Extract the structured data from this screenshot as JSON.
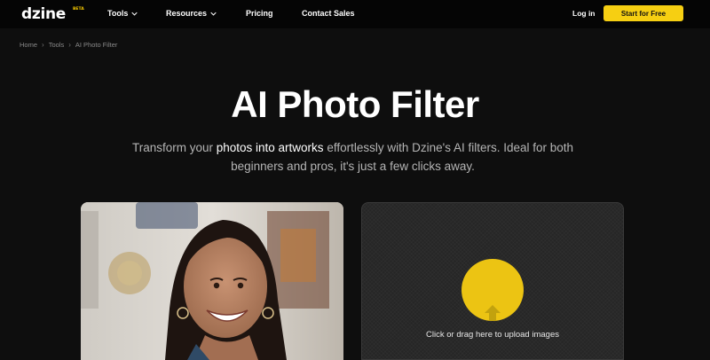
{
  "nav": {
    "logo": "dzine",
    "beta": "BETA",
    "items": [
      {
        "label": "Tools",
        "dropdown": true
      },
      {
        "label": "Resources",
        "dropdown": true
      },
      {
        "label": "Pricing",
        "dropdown": false
      },
      {
        "label": "Contact Sales",
        "dropdown": false
      }
    ],
    "login": "Log in",
    "cta": "Start for Free"
  },
  "breadcrumb": [
    "Home",
    "Tools",
    "AI Photo Filter"
  ],
  "hero": {
    "title": "AI Photo Filter",
    "subtitle_before": "Transform your ",
    "subtitle_highlight": "photos into artworks",
    "subtitle_after": " effortlessly with Dzine's AI filters. Ideal for both beginners and pros, it's just a few clicks away."
  },
  "upload": {
    "text": "Click or drag here to upload images",
    "icon": "upload-arrow-icon"
  },
  "colors": {
    "accent": "#f6cf12",
    "background": "#0e0e0e"
  }
}
